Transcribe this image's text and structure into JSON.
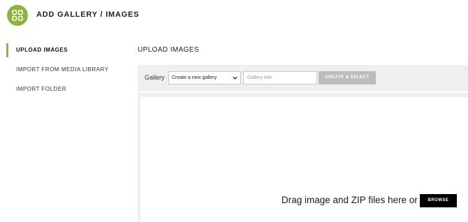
{
  "header": {
    "title": "ADD GALLERY / IMAGES",
    "logo_icon": "grid-icon",
    "brand_color": "#8fb23d"
  },
  "sidebar": {
    "items": [
      {
        "label": "UPLOAD IMAGES",
        "active": true
      },
      {
        "label": "IMPORT FROM MEDIA LIBRARY",
        "active": false
      },
      {
        "label": "IMPORT FOLDER",
        "active": false
      }
    ]
  },
  "main": {
    "title": "UPLOAD IMAGES",
    "toolbar": {
      "gallery_label": "Gallery",
      "gallery_select_value": "Create a new gallery",
      "gallery_title_placeholder": "Gallery title",
      "create_button_label": "CREATE & SELECT"
    },
    "dropzone": {
      "text": "Drag image and ZIP files here or",
      "browse_label": "BROWSE"
    }
  }
}
